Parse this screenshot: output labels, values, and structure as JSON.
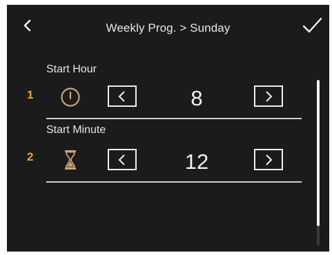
{
  "header": {
    "back_icon": "chevron-left-icon",
    "title": "Weekly Prog. > Sunday",
    "confirm_icon": "checkmark-icon"
  },
  "rows": [
    {
      "index": "1",
      "label": "Start Hour",
      "icon": "clock-icon",
      "value": "8"
    },
    {
      "index": "2",
      "label": "Start Minute",
      "icon": "hourglass-icon",
      "value": "12"
    }
  ],
  "colors": {
    "background": "#1b1b1b",
    "accent": "#e8a52e",
    "icon": "#c9a47a",
    "text": "#ececec"
  },
  "scrollbar": {
    "visible_fraction": 0.88,
    "position": 0
  }
}
